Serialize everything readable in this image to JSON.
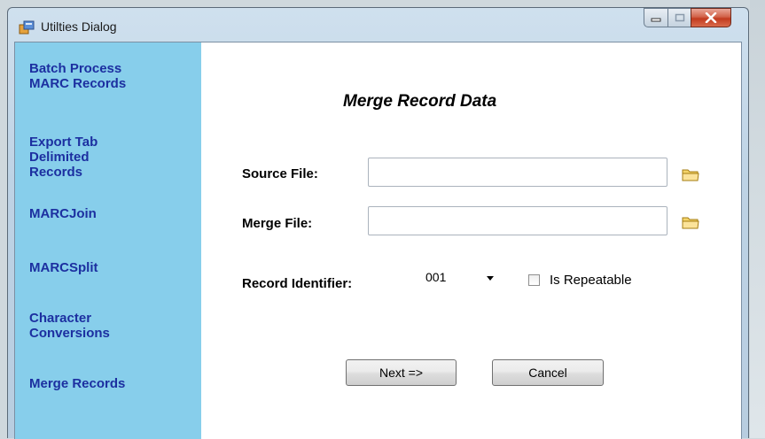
{
  "window": {
    "title": "Utilties Dialog"
  },
  "sidebar": {
    "items": [
      {
        "label": "Batch Process\nMARC Records"
      },
      {
        "label": "Export Tab\nDelimited\nRecords"
      },
      {
        "label": "MARCJoin"
      },
      {
        "label": "MARCSplit"
      },
      {
        "label": "Character\nConversions"
      },
      {
        "label": "Merge Records"
      }
    ]
  },
  "main": {
    "heading": "Merge Record Data",
    "source_file": {
      "label": "Source File:",
      "value": ""
    },
    "merge_file": {
      "label": "Merge File:",
      "value": ""
    },
    "record_identifier": {
      "label": "Record Identifier:",
      "selected": "001"
    },
    "is_repeatable": {
      "label": "Is Repeatable",
      "checked": false
    },
    "next_label": "Next =>",
    "cancel_label": "Cancel"
  },
  "icons": {
    "app": "utilities-app-icon",
    "browse": "folder-icon",
    "dropdown": "caret-down-icon"
  },
  "colors": {
    "sidebar_bg": "#87CEEB",
    "nav_text": "#1C2FA0",
    "close_button": "#C23A1E"
  }
}
